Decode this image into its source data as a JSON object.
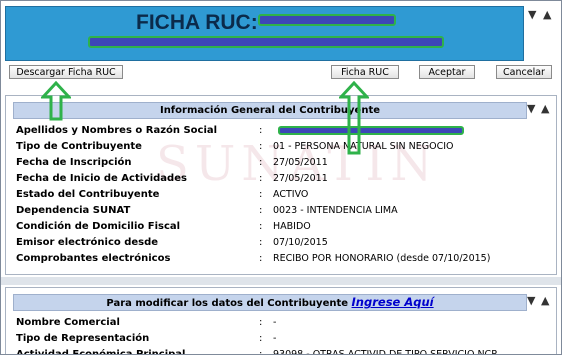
{
  "header": {
    "title": "FICHA RUC:"
  },
  "toolbar": {
    "download_label": "Descargar Ficha RUC",
    "ficha_label": "Ficha RUC",
    "accept_label": "Aceptar",
    "cancel_label": "Cancelar"
  },
  "section1": {
    "title": "Información General del Contribuyente",
    "watermark": "SUNATIN",
    "rows": [
      {
        "label": "Apellidos y Nombres o Razón Social",
        "value": ""
      },
      {
        "label": "Tipo de Contribuyente",
        "value": "01 - PERSONA NATURAL SIN NEGOCIO"
      },
      {
        "label": "Fecha de Inscripción",
        "value": "27/05/2011"
      },
      {
        "label": "Fecha de Inicio de Actividades",
        "value": "27/05/2011"
      },
      {
        "label": "Estado del Contribuyente",
        "value": "ACTIVO"
      },
      {
        "label": "Dependencia SUNAT",
        "value": "0023 - INTENDENCIA LIMA"
      },
      {
        "label": "Condición de Domicilio Fiscal",
        "value": "HABIDO"
      },
      {
        "label": "Emisor electrónico desde",
        "value": "07/10/2015"
      },
      {
        "label": "Comprobantes electrónicos",
        "value": "RECIBO POR HONORARIO (desde 07/10/2015)"
      }
    ]
  },
  "section2": {
    "title_prefix": "Para modificar los datos del Contribuyente",
    "link_label": "Ingrese Aquí",
    "rows": [
      {
        "label": "Nombre Comercial",
        "value": "-"
      },
      {
        "label": "Tipo de Representación",
        "value": "-"
      },
      {
        "label": "Actividad Económica Principal",
        "value": "93098 - OTRAS ACTIVID.DE TIPO SERVICIO NCP"
      }
    ]
  },
  "separator": ":",
  "colors": {
    "header_bg": "#2f9ad3",
    "section_bar": "#c5d4ec",
    "highlight_green": "#2fb24a",
    "redaction_blue": "#3d46b8",
    "link": "#0000cc"
  },
  "icons": {
    "collapse": "triangle-down",
    "close": "triangle-up"
  }
}
